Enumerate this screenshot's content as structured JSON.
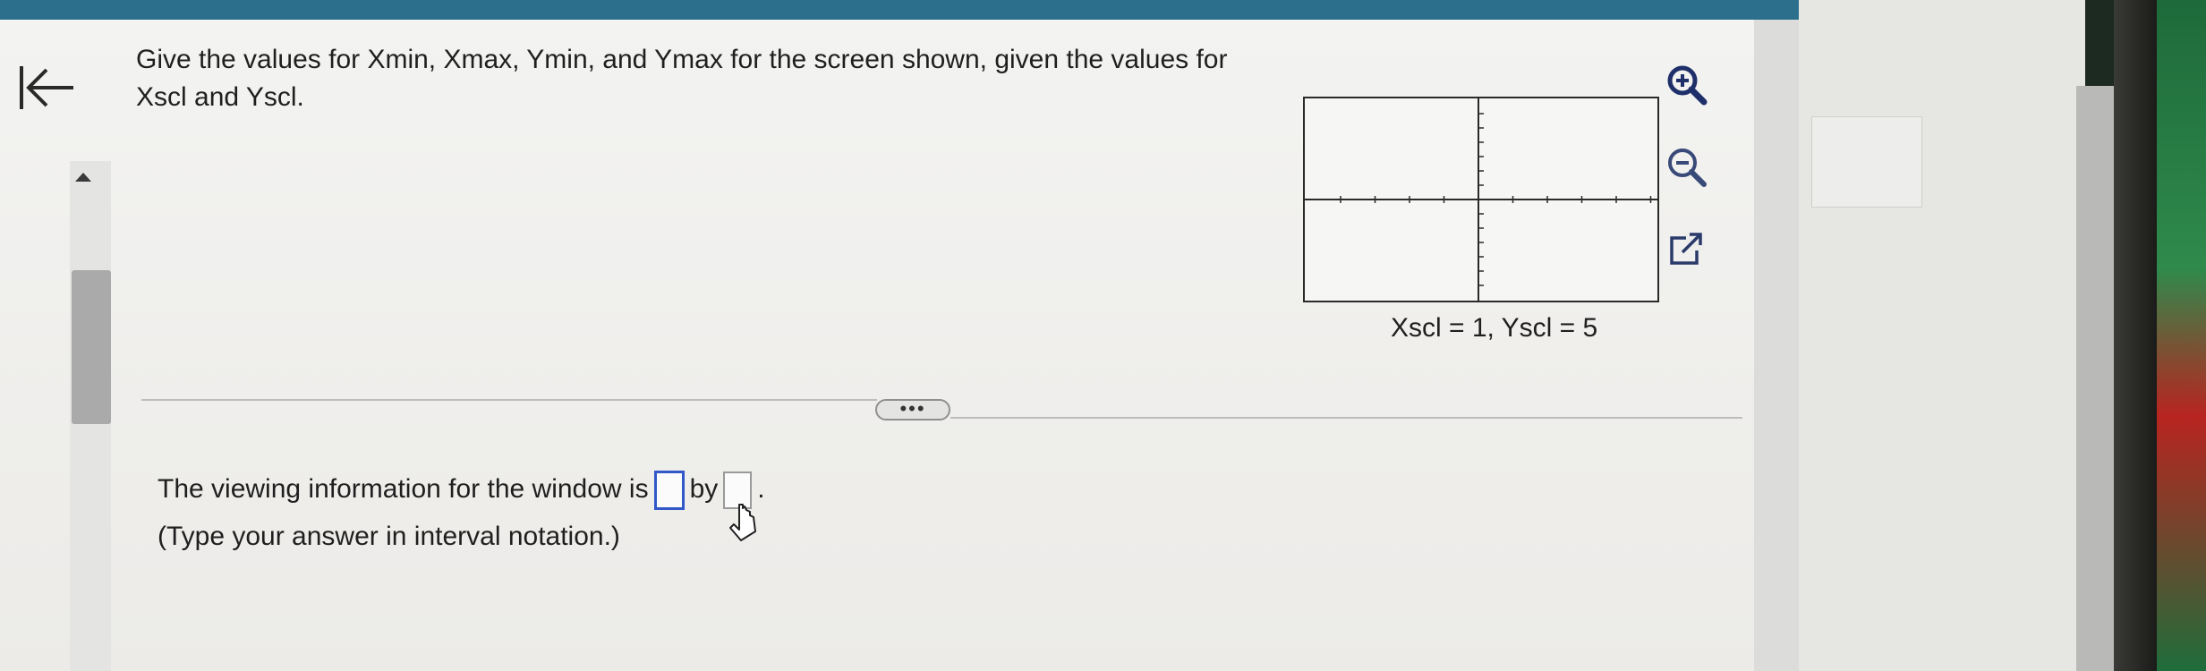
{
  "question": {
    "text": "Give the values for Xmin, Xmax, Ymin, and Ymax for the screen shown, given the values for Xscl and Yscl."
  },
  "graph": {
    "caption": "Xscl = 1, Yscl = 5"
  },
  "tools": {
    "zoom_in_icon": "zoom-in-icon",
    "zoom_out_icon": "zoom-out-icon",
    "popout_icon": "external-link-icon"
  },
  "expand": {
    "label": "•••"
  },
  "answer": {
    "prefix": "The viewing information for the window is",
    "connector": "by",
    "suffix": ".",
    "box1_value": "",
    "box2_value": "",
    "hint": "(Type your answer in interval notation.)"
  },
  "colors": {
    "accent": "#3157c9",
    "top_bar": "#2c6f8c"
  }
}
